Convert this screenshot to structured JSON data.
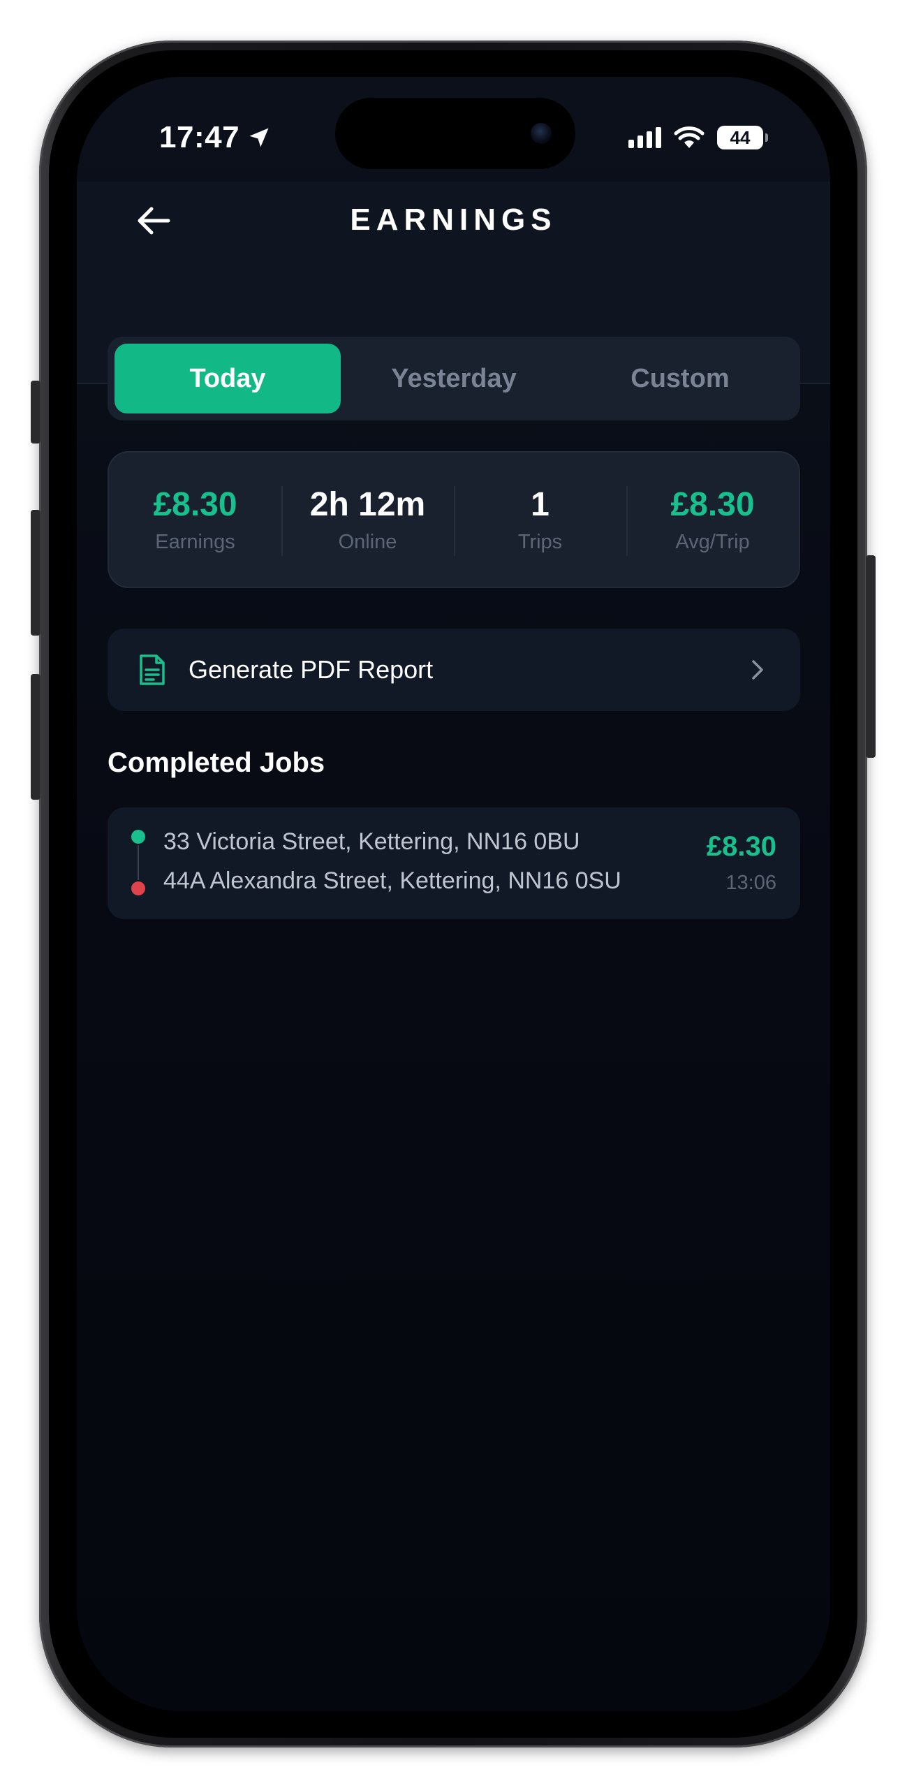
{
  "status_bar": {
    "time": "17:47",
    "battery": "44",
    "icons": [
      "location-arrow-icon",
      "cellular-signal-icon",
      "wifi-icon",
      "battery-icon"
    ]
  },
  "header": {
    "title": "EARNINGS",
    "back_icon": "arrow-left-icon"
  },
  "tabs": [
    {
      "label": "Today",
      "active": true
    },
    {
      "label": "Yesterday",
      "active": false
    },
    {
      "label": "Custom",
      "active": false
    }
  ],
  "stats": [
    {
      "value": "£8.30",
      "label": "Earnings",
      "accent": true
    },
    {
      "value": "2h 12m",
      "label": "Online",
      "accent": false
    },
    {
      "value": "1",
      "label": "Trips",
      "accent": false
    },
    {
      "value": "£8.30",
      "label": "Avg/Trip",
      "accent": true
    }
  ],
  "report": {
    "label": "Generate PDF Report",
    "icon": "document-icon"
  },
  "completed": {
    "title": "Completed Jobs",
    "jobs": [
      {
        "from": "33 Victoria Street, Kettering, NN16 0BU",
        "to": "44A Alexandra Street, Kettering, NN16 0SU",
        "amount": "£8.30",
        "time": "13:06"
      }
    ]
  },
  "colors": {
    "accent": "#12b886",
    "accent_text": "#18c08d",
    "dropoff": "#e0434b",
    "background": "#070a13",
    "card": "#1a212e"
  }
}
